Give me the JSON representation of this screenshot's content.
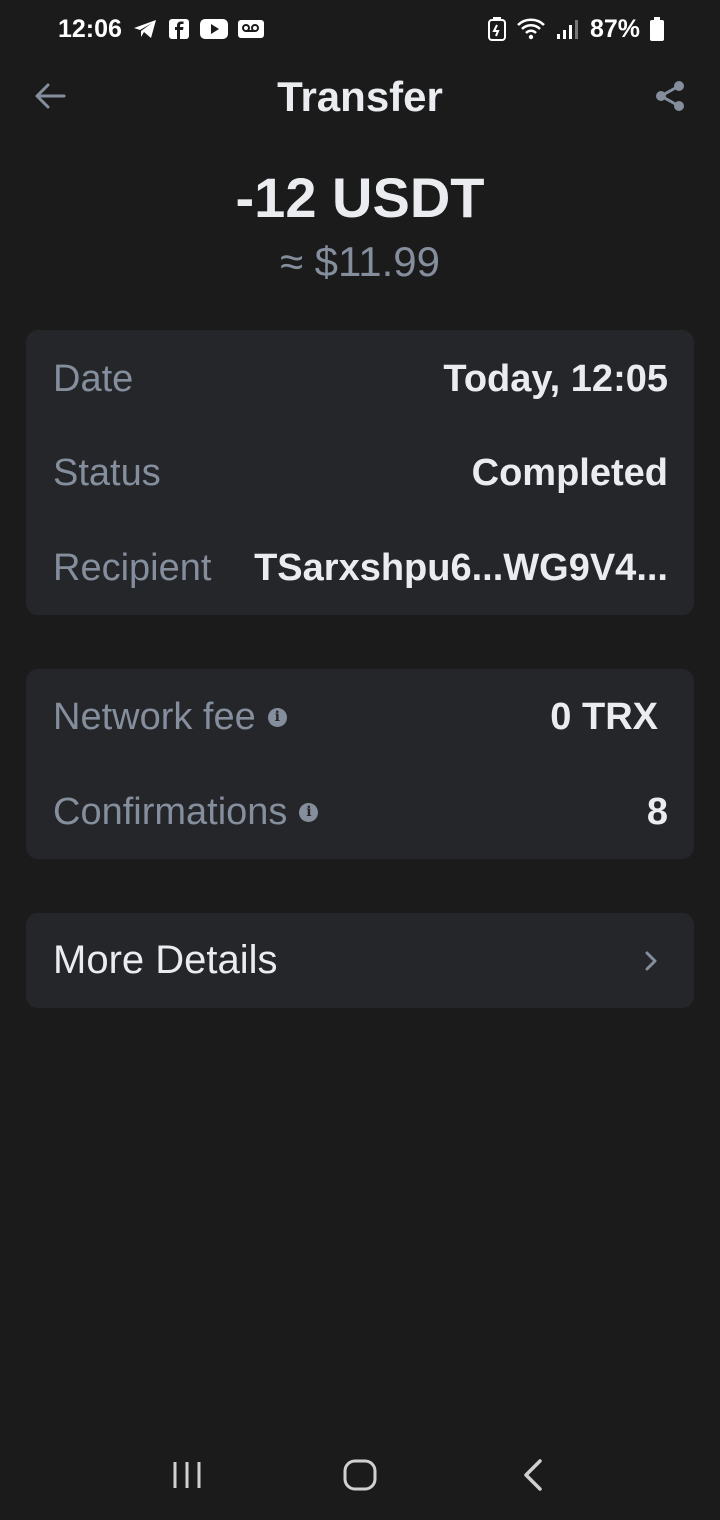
{
  "status_bar": {
    "time": "12:06",
    "battery": "87%",
    "left_icons": [
      "telegram-icon",
      "facebook-icon",
      "youtube-icon",
      "voicemail-icon"
    ],
    "right_icons": [
      "battery-saver-icon",
      "wifi-icon",
      "signal-icon",
      "battery-icon"
    ]
  },
  "header": {
    "title": "Transfer",
    "back_icon": "arrow-left-icon",
    "share_icon": "share-icon"
  },
  "transaction": {
    "amount": "-12 USDT",
    "fiat": "≈ $11.99"
  },
  "details": {
    "date_label": "Date",
    "date_value": "Today, 12:05",
    "status_label": "Status",
    "status_value": "Completed",
    "recipient_label": "Recipient",
    "recipient_value": "TSarxshpu6...WG9V4..."
  },
  "fees": {
    "network_fee_label": "Network fee",
    "network_fee_value": "0 TRX",
    "confirmations_label": "Confirmations",
    "confirmations_value": "8",
    "info_icon": "info-icon"
  },
  "more": {
    "label": "More Details",
    "icon": "chevron-right-icon"
  },
  "nav": {
    "recents_icon": "recents-icon",
    "home_icon": "home-icon",
    "back_icon": "back-icon"
  },
  "colors": {
    "background": "#1b1b1c",
    "card": "#252629",
    "primary_text": "#eaecef",
    "secondary_text": "#848e9c"
  }
}
